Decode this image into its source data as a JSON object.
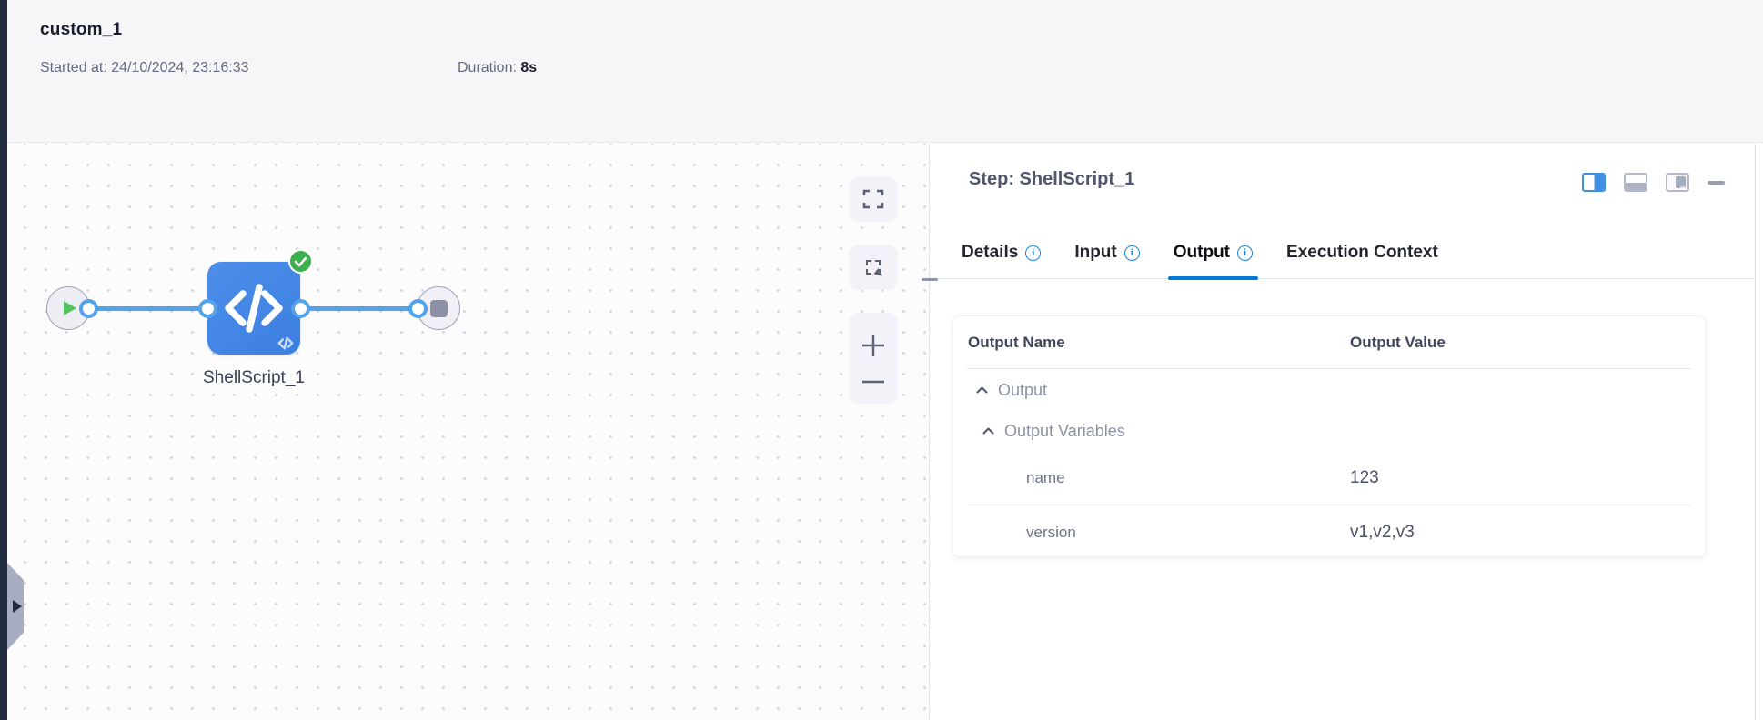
{
  "header": {
    "title": "custom_1",
    "started": "Started at: 24/10/2024, 23:16:33",
    "duration_label": "Duration:",
    "duration_value": "8s"
  },
  "canvas": {
    "node_label": "ShellScript_1",
    "zoom_in_glyph": "+",
    "zoom_out_glyph": "−",
    "icons": {
      "start": "play-circle",
      "step": "code-shell-script",
      "status": "success-check",
      "end": "stop-circle",
      "tools": [
        "expand-fullscreen",
        "marquee-select",
        "zoom-in",
        "zoom-out"
      ]
    }
  },
  "panel": {
    "title": "Step: ShellScript_1",
    "info_glyph": "i",
    "minimize_glyph": "",
    "tabs": [
      {
        "label": "Details"
      },
      {
        "label": "Input"
      },
      {
        "label": "Output"
      },
      {
        "label": "Execution Context"
      }
    ],
    "active_tab": "Output",
    "table": {
      "col_name": "Output Name",
      "col_value": "Output Value",
      "group1": "Output",
      "group2": "Output Variables",
      "rows": [
        {
          "name": "name",
          "value": "123"
        },
        {
          "name": "version",
          "value": "v1,v2,v3"
        }
      ]
    }
  },
  "colors": {
    "accent_blue": "#0278d5",
    "node_blue": "#4286e6",
    "edge_blue": "#53a2ea",
    "success_green": "#3db04e",
    "header_bg": "#f6f6f9",
    "dark_strip": "#232b40"
  }
}
